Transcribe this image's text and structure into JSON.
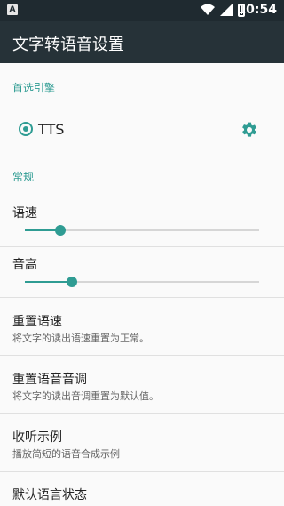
{
  "statusbar": {
    "time": "10:54",
    "notification_icon": "A"
  },
  "appbar": {
    "title": "文字转语音设置"
  },
  "sections": {
    "preferred_engine": "首选引擎",
    "general": "常规"
  },
  "engine": {
    "label": "TTS",
    "selected": true
  },
  "sliders": {
    "speech_rate": {
      "label": "语速",
      "value_fraction": 0.15
    },
    "pitch": {
      "label": "音高",
      "value_fraction": 0.2
    }
  },
  "items": [
    {
      "title": "重置语速",
      "subtitle": "将文字的读出语速重置为正常。"
    },
    {
      "title": "重置语音音调",
      "subtitle": "将文字的读出音调重置为默认值。"
    },
    {
      "title": "收听示例",
      "subtitle": "播放简短的语音合成示例"
    },
    {
      "title": "默认语言状态",
      "subtitle": ""
    }
  ],
  "colors": {
    "accent": "#2f9c93",
    "appbar": "#263238",
    "statusbar": "#1f2a30"
  }
}
